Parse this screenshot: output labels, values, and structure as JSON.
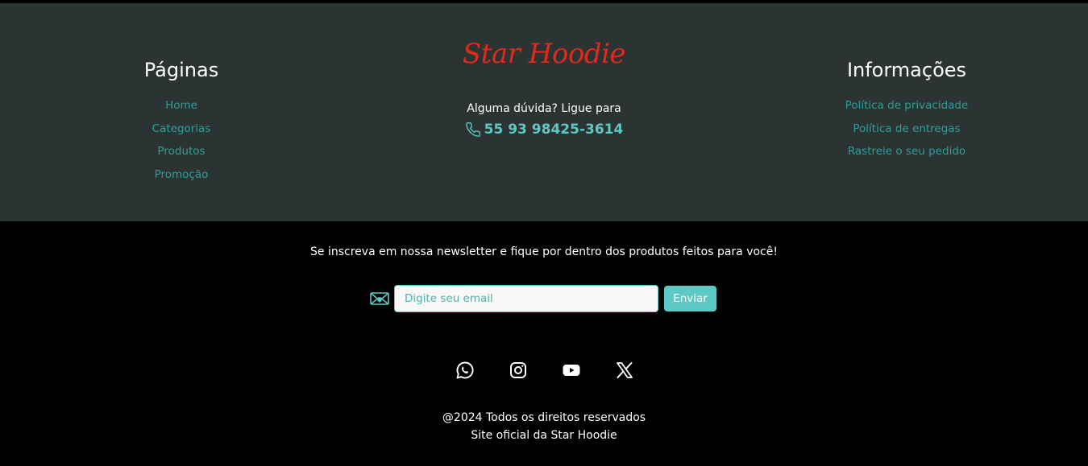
{
  "brand": {
    "name": "Star Hoodie",
    "color": "#e02a1c"
  },
  "pages": {
    "title": "Páginas",
    "links": [
      {
        "label": "Home"
      },
      {
        "label": "Categorias"
      },
      {
        "label": "Produtos"
      },
      {
        "label": "Promoção"
      }
    ]
  },
  "contact": {
    "label": "Alguma dúvida? Ligue para",
    "phone": "55 93 98425-3614",
    "icon": "phone-icon"
  },
  "info": {
    "title": "Informações",
    "links": [
      {
        "label": "Política de privacidade"
      },
      {
        "label": "Política de entregas"
      },
      {
        "label": "Rastreie o seu pedido"
      }
    ]
  },
  "newsletter": {
    "text": "Se inscreva em nossa newsletter e fique por dentro dos produtos feitos para você!",
    "placeholder": "Digite seu email",
    "button": "Enviar",
    "icon": "envelope-heart-icon"
  },
  "social": [
    {
      "icon": "whatsapp-icon"
    },
    {
      "icon": "instagram-icon"
    },
    {
      "icon": "youtube-icon"
    },
    {
      "icon": "x-twitter-icon"
    }
  ],
  "copyright": {
    "line1": "@2024 Todos os direitos reservados",
    "line2": "Site oficial da Star Hoodie"
  },
  "colors": {
    "accent": "#5ec9c4",
    "link": "#2e9e9a",
    "footer_top_bg": "#2c3433",
    "footer_bottom_bg": "#000000"
  }
}
